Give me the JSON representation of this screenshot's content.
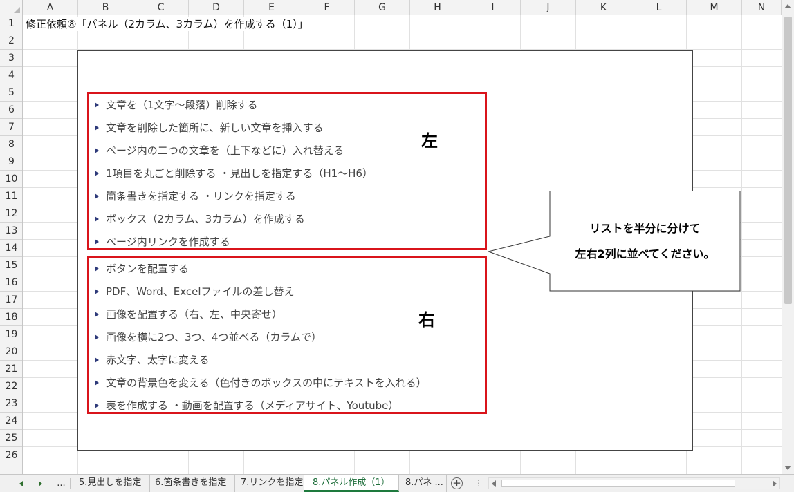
{
  "columns": [
    "A",
    "B",
    "C",
    "D",
    "E",
    "F",
    "G",
    "H",
    "I",
    "J",
    "K",
    "L",
    "M",
    "N"
  ],
  "rows": [
    "1",
    "2",
    "3",
    "4",
    "5",
    "6",
    "7",
    "8",
    "9",
    "10",
    "11",
    "12",
    "13",
    "14",
    "15",
    "16",
    "17",
    "18",
    "19",
    "20",
    "21",
    "22",
    "23",
    "24",
    "25",
    "26"
  ],
  "cell_a1": "修正依頼⑧「パネル（2カラム、3カラム）を作成する（1）」",
  "left_panel": {
    "label": "左",
    "items": [
      "文章を（1文字～段落）削除する",
      "文章を削除した箇所に、新しい文章を挿入する",
      "ページ内の二つの文章を（上下などに）入れ替える",
      "1項目を丸ごと削除する ・見出しを指定する（H1～H6）",
      "箇条書きを指定する ・リンクを指定する",
      "ボックス（2カラム、3カラム）を作成する",
      "ページ内リンクを作成する"
    ]
  },
  "right_panel": {
    "label": "右",
    "items": [
      "ボタンを配置する",
      "PDF、Word、Excelファイルの差し替え",
      "画像を配置する（右、左、中央寄せ）",
      "画像を横に2つ、3つ、4つ並べる（カラムで）",
      "赤文字、太字に変える",
      "文章の背景色を変える（色付きのボックスの中にテキストを入れる）",
      "表を作成する ・動画を配置する（メディアサイト、Youtube）"
    ]
  },
  "callout": {
    "line1": "リストを半分に分けて",
    "line2": "左右2列に並べてください。"
  },
  "tabs": {
    "ellipsis": "...",
    "items": [
      "5.見出しを指定",
      "6.箇条書きを指定",
      "7.リンクを指定",
      "8.パネル作成（1）",
      "8.パネ ..."
    ],
    "active_index": 3,
    "add_symbol": "+"
  },
  "colors": {
    "accent_red": "#d9141b",
    "active_tab": "#1e7a3e",
    "bullet": "#2e3a7a"
  }
}
